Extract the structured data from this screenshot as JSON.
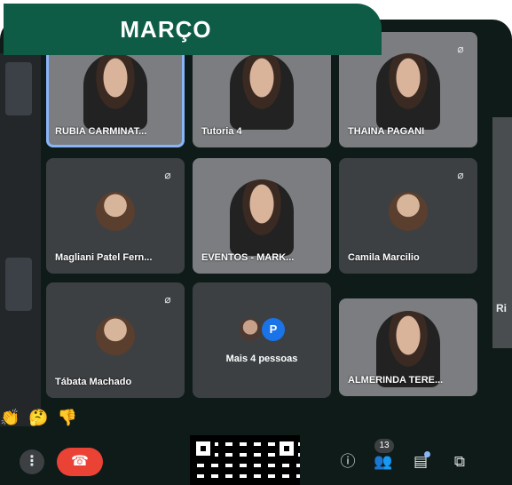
{
  "banner": {
    "title": "MARÇO"
  },
  "tiles": [
    {
      "name": "RUBIA CARMINAT...",
      "type": "video",
      "muted": false
    },
    {
      "name": "Tutoria 4",
      "type": "video",
      "muted": false
    },
    {
      "name": "THAINA PAGANI",
      "type": "video",
      "muted": true
    },
    {
      "name": "Magliani Patel Fern...",
      "type": "avatar",
      "muted": true
    },
    {
      "name": "EVENTOS - MARK...",
      "type": "video",
      "muted": false
    },
    {
      "name": "Camila Marcilio",
      "type": "avatar",
      "muted": true
    },
    {
      "name": "Tábata Machado",
      "type": "avatar",
      "muted": true
    },
    {
      "name": "",
      "type": "more",
      "muted": false
    },
    {
      "name": "ALMERINDA TERE...",
      "type": "video",
      "muted": false
    }
  ],
  "more_tile": {
    "badge": "P",
    "label": "Mais 4 pessoas"
  },
  "side_tile": {
    "label": "Ri"
  },
  "reactions": [
    "👏",
    "🤔",
    "👎"
  ],
  "toolbar": {
    "participant_count": "13"
  },
  "icons": {
    "more": "more-vert-icon",
    "leave": "call-end-icon",
    "info": "info-icon",
    "people": "people-icon",
    "chat": "chat-icon",
    "activities": "activities-icon",
    "mute": "mic-off-icon"
  },
  "colors": {
    "banner": "#0f5c46",
    "leave_button": "#ea4335",
    "badge": "#1a73e8"
  }
}
